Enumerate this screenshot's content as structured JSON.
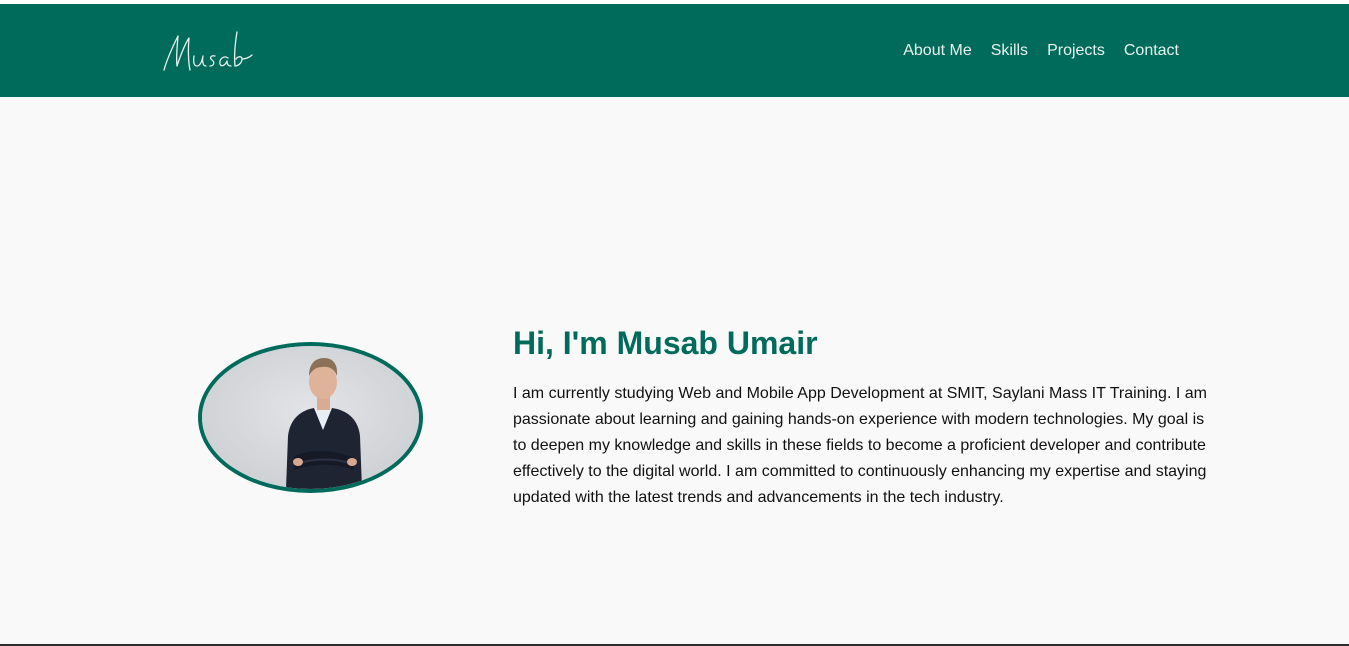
{
  "header": {
    "logo_text": "Musab",
    "nav": [
      {
        "label": "About Me"
      },
      {
        "label": "Skills"
      },
      {
        "label": "Projects"
      },
      {
        "label": "Contact"
      }
    ]
  },
  "hero": {
    "title": "Hi, I'm Musab Umair",
    "description": "I am currently studying Web and Mobile App Development at SMIT, Saylani Mass IT Training. I am passionate about learning and gaining hands-on experience with modern technologies. My goal is to deepen my knowledge and skills in these fields to become a proficient developer and contribute effectively to the digital world. I am committed to continuously enhancing my expertise and staying updated with the latest trends and advancements in the tech industry."
  },
  "colors": {
    "brand": "#016b5b",
    "background": "#f9f9f9",
    "nav_text": "#e6f2ef"
  }
}
